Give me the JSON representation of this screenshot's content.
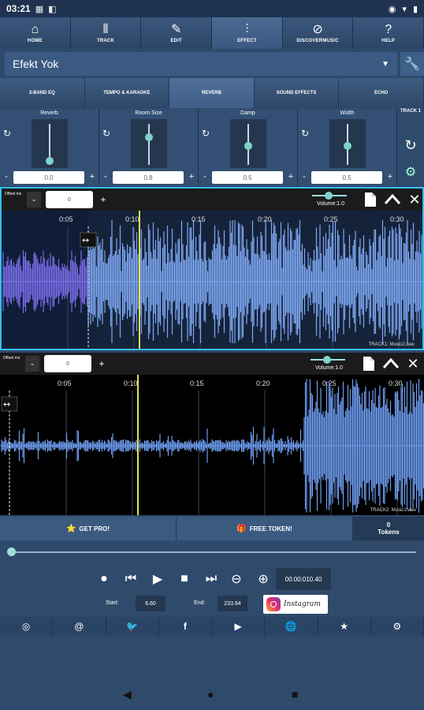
{
  "status": {
    "time": "03:21"
  },
  "top_nav": [
    {
      "label": "HOME",
      "icon": "home-icon"
    },
    {
      "label": "TRACK",
      "icon": "waveform-icon"
    },
    {
      "label": "EDIT",
      "icon": "edit-icon"
    },
    {
      "label": "EFFECT",
      "icon": "sliders-icon"
    },
    {
      "label": "DISCOVERMUSIC",
      "icon": "compass-icon"
    },
    {
      "label": "HELP",
      "icon": "help-icon"
    }
  ],
  "preset": {
    "value": "Efekt Yok"
  },
  "effect_tabs": [
    "3-BAND EQ",
    "TEMPO & KARAOKE",
    "REVERB",
    "SOUND EFFECTS",
    "ECHO"
  ],
  "reverb_controls": [
    {
      "title": "Reverb",
      "value": "0.0",
      "level": 0.0
    },
    {
      "title": "Room Size",
      "value": "0.8",
      "level": 0.8
    },
    {
      "title": "Damp",
      "value": "0.5",
      "level": 0.5
    },
    {
      "title": "Width",
      "value": "0.5",
      "level": 0.5
    }
  ],
  "track_side": {
    "label": "TRACK 1"
  },
  "tracks": [
    {
      "offset_label": "Offset ms",
      "offset_value": "0",
      "volume_label": "Volume:1.0",
      "volume_level": 1.0,
      "time_ticks": [
        "0:05",
        "0:10",
        "0:15",
        "0:20",
        "0:25",
        "0:30"
      ],
      "track_label": "TRACK1: Music2.wav"
    },
    {
      "offset_label": "Offset ms",
      "offset_value": "0",
      "volume_label": "Volume:1.0",
      "volume_level": 1.0,
      "time_ticks": [
        "0:05",
        "0:10",
        "0:15",
        "0:20",
        "0:25",
        "0:30"
      ],
      "track_label": "TRACK2: Music1.wav"
    }
  ],
  "promo": {
    "get_pro": "GET PRO!",
    "free_token": "FREE TOKEN!",
    "tokens_count": "0",
    "tokens_label": "Tokens"
  },
  "transport": {
    "time": "00:00:010.40"
  },
  "range": {
    "start_label": "Start:",
    "start_value": "6.60",
    "end_label": "End:",
    "end_value": "233.94"
  },
  "instagram": {
    "text": "Instagram"
  },
  "colors": {
    "accent": "#32c0ea",
    "playhead": "#e7e052",
    "wave": "#6e9cf0",
    "wave_selected": "#7a6de8"
  }
}
